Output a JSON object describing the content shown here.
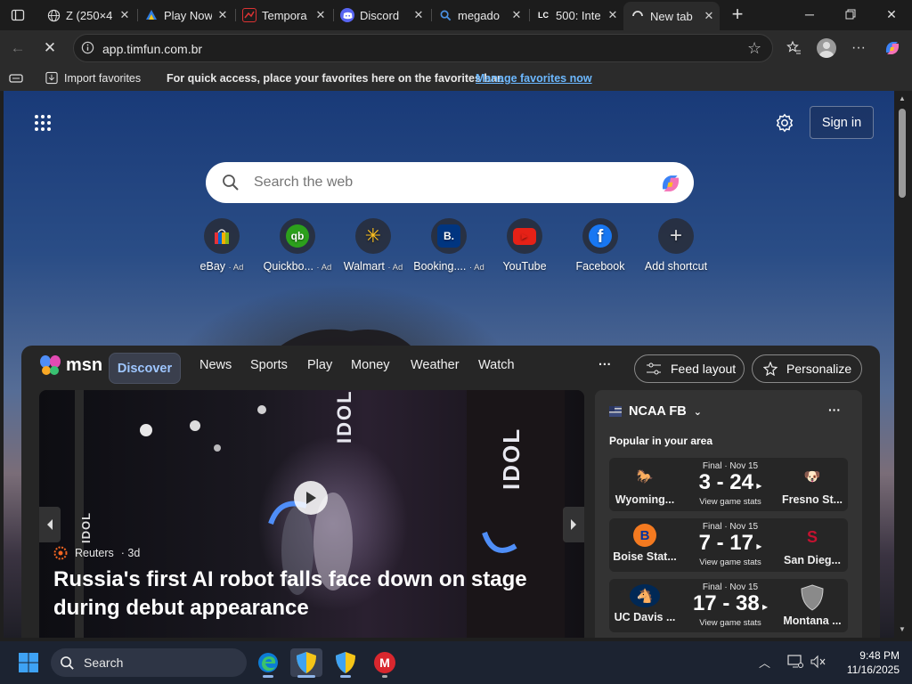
{
  "tabs": [
    {
      "title": "Z (250×4",
      "icon": "globe-icon"
    },
    {
      "title": "Play Now",
      "icon": "play-now-icon"
    },
    {
      "title": "Tempora",
      "icon": "tempora-icon"
    },
    {
      "title": "Discord",
      "icon": "discord-icon"
    },
    {
      "title": "megado",
      "icon": "search-icon"
    },
    {
      "title": "500: Inte",
      "icon": "lc-icon",
      "icon_text": "LC"
    },
    {
      "title": "New tab",
      "icon": "loading-icon"
    }
  ],
  "address": {
    "url": "app.timfun.com.br"
  },
  "favorites_bar": {
    "import_label": "Import favorites",
    "message": "For quick access, place your favorites here on the favorites bar.",
    "manage_link": "Manage favorites now"
  },
  "newtab": {
    "sign_in": "Sign in",
    "search_placeholder": "Search the web",
    "shortcuts": [
      {
        "label": "eBay",
        "ad": "· Ad",
        "icon": "ebay-icon"
      },
      {
        "label": "Quickbo...",
        "ad": "· Ad",
        "icon": "quickbooks-icon",
        "glyph": "qb"
      },
      {
        "label": "Walmart",
        "ad": "· Ad",
        "icon": "walmart-icon",
        "glyph": "✳"
      },
      {
        "label": "Booking....",
        "ad": "· Ad",
        "icon": "booking-icon",
        "glyph": "B."
      },
      {
        "label": "YouTube",
        "ad": "",
        "icon": "youtube-icon",
        "glyph": "▶"
      },
      {
        "label": "Facebook",
        "ad": "",
        "icon": "facebook-icon",
        "glyph": "f"
      },
      {
        "label": "Add shortcut",
        "ad": "",
        "icon": "plus-icon",
        "glyph": "+"
      }
    ]
  },
  "msn": {
    "brand": "msn",
    "nav": [
      "Discover",
      "News",
      "Sports",
      "Play",
      "Money",
      "Weather",
      "Watch"
    ],
    "more": "···",
    "feed_layout": "Feed layout",
    "personalize": "Personalize",
    "hero": {
      "source": "Reuters",
      "age": "· 3d",
      "headline": "Russia's first AI robot falls face down on stage during debut appearance",
      "sign_text": "IDOL"
    },
    "sports_card": {
      "league": "NCAA FB",
      "subtitle": "Popular in your area",
      "games": [
        {
          "status": "Final · Nov 15",
          "score": "3 - 24",
          "home": "Wyoming...",
          "away": "Fresno St...",
          "link": "View game stats"
        },
        {
          "status": "Final · Nov 15",
          "score": "7 - 17",
          "home": "Boise Stat...",
          "away": "San Dieg...",
          "link": "View game stats"
        },
        {
          "status": "Final · Nov 15",
          "score": "17 - 38",
          "home": "UC Davis ...",
          "away": "Montana ...",
          "link": "View game stats"
        }
      ]
    }
  },
  "taskbar": {
    "search": "Search",
    "time": "9:48 PM",
    "date": "11/16/2025"
  },
  "colors": {
    "accent_link": "#6cb8ff",
    "discover_bg": "#3a3f4d",
    "youtube": "#e62117",
    "facebook": "#1877f2"
  }
}
